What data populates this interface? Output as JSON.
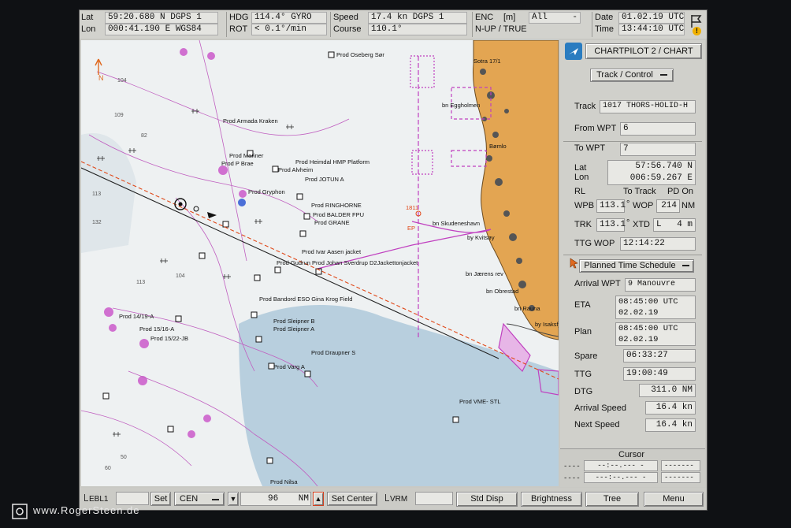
{
  "topbar": {
    "lat_label": "Lat",
    "lat_value": "59:20.680 N DGPS 1",
    "lon_label": "Lon",
    "lon_value": "000:41.190 E WGS84",
    "hdg_label": "HDG",
    "hdg_value": "114.4° GYRO",
    "rot_label": "ROT",
    "rot_value": "<  0.1°/min",
    "speed_label": "Speed",
    "speed_value": "17.4  kn DGPS 1",
    "course_label": "Course",
    "course_value": "110.1°",
    "enc_label": "ENC",
    "enc_unit": "[m]",
    "enc_mode": "N-UP / TRUE",
    "enc_select": "All",
    "enc_dash": "-",
    "date_label": "Date",
    "date_value": "01.02.19 UTC",
    "time_label": "Time",
    "time_value": "13:44:10 UTC",
    "alert_symbol": "!"
  },
  "panel": {
    "title": "CHARTPILOT 2 / CHART",
    "mode_dropdown": "Track / Control",
    "track_label": "Track",
    "track_value": "1017 THORS-HOLID-H",
    "from_wpt_label": "From WPT",
    "from_wpt_value": "6",
    "to_wpt_label": "To WPT",
    "to_wpt_value": "7",
    "lat_label": "Lat",
    "lon_label": "Lon",
    "wpt_lat": "57:56.740 N",
    "wpt_lon": "006:59.267 E",
    "rl_label": "RL",
    "to_track_label": "To Track",
    "pd_on_label": "PD On",
    "wpb_label": "WPB",
    "wpb_value": "113.1",
    "deg": "°",
    "wop_label": "WOP",
    "wop_value": "214",
    "nm_unit": "NM",
    "trk_label": "TRK",
    "trk_value": "113.1",
    "xtd_label": "XTD",
    "xtd_side": "L",
    "xtd_value": "4 m",
    "ttg_wop_label": "TTG WOP",
    "ttg_wop_value": "12:14:22",
    "schedule_dropdown": "Planned Time Schedule",
    "arrival_wpt_label": "Arrival WPT",
    "arrival_wpt_value": "9 Manouvre",
    "eta_label": "ETA",
    "eta_time": "08:45:00 UTC",
    "eta_date": "02.02.19",
    "plan_label": "Plan",
    "plan_time": "08:45:00 UTC",
    "plan_date": "02.02.19",
    "spare_label": "Spare",
    "spare_value": "06:33:27",
    "ttg_label": "TTG",
    "ttg_value": "19:00:49",
    "dtg_label": "DTG",
    "dtg_value": "311.0 NM",
    "arrival_speed_label": "Arrival Speed",
    "arrival_speed_value": "16.4 kn",
    "next_speed_label": "Next Speed",
    "next_speed_value": "16.4 kn"
  },
  "cursor_panel": {
    "title": "Cursor",
    "row1_left": "----",
    "row1_mid": "--:--.--- -",
    "row1_right": "-------",
    "row2_left": "----",
    "row2_mid": "---:--.--- -",
    "row2_right": "-------"
  },
  "bottombar": {
    "ebl_label": "EBL1",
    "set_label": "Set",
    "cen_value": "CEN",
    "range_value": "96",
    "range_unit": "NM",
    "set_center_label": "Set Center",
    "vrm_label": "VRM",
    "std_disp_label": "Std Disp",
    "brightness_label": "Brightness",
    "tree_label": "Tree",
    "menu_label": "Menu"
  },
  "watermark": "www.RogerSteen.de",
  "chart_labels": {
    "north": "N",
    "oseberg": "Prod Oseberg Sør",
    "armada": "Prod Armada Kraken",
    "mariner": "Prod Mariner",
    "pbrae": "Prod P Brae",
    "heimdal": "Prod Heimdal HMP Platform",
    "alvheim": "Prod Alvheim",
    "jotun": "Prod JOTUN A",
    "gryphon": "Prod Gryphon",
    "ringhorne": "Prod RINGHORNE",
    "balder": "Prod BALDER FPU",
    "grane": "Prod GRANE",
    "ivar": "Prod Ivar Aasen jacket",
    "sverdrup": "Prod Gudrun Prod Johan Sverdrup D2Jackettonjacket",
    "gina": "Prod Bandord ESO  Gina Krog Field",
    "sleipnerb": "Prod Sleipner B",
    "sleipnera": "Prod Sleipner A",
    "draupner": "Prod Draupner S",
    "varg": "Prod Varg A",
    "vme": "Prod VME- STL",
    "p1419": "Prod 14/19-A",
    "p1516": "Prod 15/16-A",
    "p1522": "Prod 15/22-JB",
    "nilsa": "Prod Nilsa",
    "sotra": "Sotra  17/1",
    "eggholmen": "bn Eggholmen",
    "bomlo": "Bømlo",
    "skudeneshavn": "bn Skudeneshavn",
    "kvitsoy": "by Kvitsøy",
    "jaerens": "bn Jærens rev",
    "obrestad": "bn Obrestad",
    "rauna": "bn Rauna",
    "isaksfjell": "by Isaksfjell",
    "d1811": "1811",
    "ep": "EP"
  },
  "colors": {
    "land": "#e3a552",
    "sea": "#eef1f2",
    "shallow": "#b8cfde",
    "magenta": "#c040c0",
    "own_track": "#222222",
    "planned_route": "#e04818",
    "panel": "#d0d0cb",
    "logo": "#2a7cc0"
  }
}
